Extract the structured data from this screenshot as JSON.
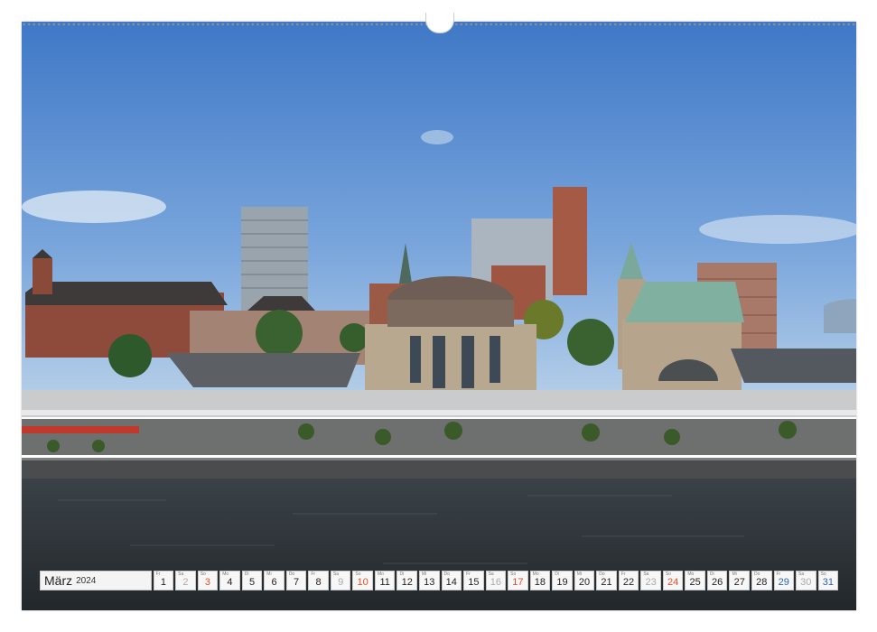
{
  "calendar": {
    "month": "März",
    "year": "2024",
    "days": [
      {
        "wd": "Fr",
        "n": "1",
        "style": ""
      },
      {
        "wd": "Sa",
        "n": "2",
        "style": "muted"
      },
      {
        "wd": "So",
        "n": "3",
        "style": "red"
      },
      {
        "wd": "Mo",
        "n": "4",
        "style": ""
      },
      {
        "wd": "Di",
        "n": "5",
        "style": ""
      },
      {
        "wd": "Mi",
        "n": "6",
        "style": ""
      },
      {
        "wd": "Do",
        "n": "7",
        "style": ""
      },
      {
        "wd": "Fr",
        "n": "8",
        "style": ""
      },
      {
        "wd": "Sa",
        "n": "9",
        "style": "muted"
      },
      {
        "wd": "So",
        "n": "10",
        "style": "red"
      },
      {
        "wd": "Mo",
        "n": "11",
        "style": ""
      },
      {
        "wd": "Di",
        "n": "12",
        "style": ""
      },
      {
        "wd": "Mi",
        "n": "13",
        "style": ""
      },
      {
        "wd": "Do",
        "n": "14",
        "style": ""
      },
      {
        "wd": "Fr",
        "n": "15",
        "style": ""
      },
      {
        "wd": "Sa",
        "n": "16",
        "style": "muted"
      },
      {
        "wd": "So",
        "n": "17",
        "style": "red"
      },
      {
        "wd": "Mo",
        "n": "18",
        "style": ""
      },
      {
        "wd": "Di",
        "n": "19",
        "style": ""
      },
      {
        "wd": "Mi",
        "n": "20",
        "style": ""
      },
      {
        "wd": "Do",
        "n": "21",
        "style": ""
      },
      {
        "wd": "Fr",
        "n": "22",
        "style": ""
      },
      {
        "wd": "Sa",
        "n": "23",
        "style": "muted"
      },
      {
        "wd": "So",
        "n": "24",
        "style": "red"
      },
      {
        "wd": "Mo",
        "n": "25",
        "style": ""
      },
      {
        "wd": "Di",
        "n": "26",
        "style": ""
      },
      {
        "wd": "Mi",
        "n": "27",
        "style": ""
      },
      {
        "wd": "Do",
        "n": "28",
        "style": ""
      },
      {
        "wd": "Fr",
        "n": "29",
        "style": "blue"
      },
      {
        "wd": "Sa",
        "n": "30",
        "style": "muted"
      },
      {
        "wd": "So",
        "n": "31",
        "style": "blue"
      }
    ]
  },
  "colors": {
    "sky_top": "#3f78c6",
    "sky_bottom": "#a9c7e6",
    "water": "#2d3338",
    "sunday": "#e2502d",
    "holiday": "#2a64b8"
  }
}
